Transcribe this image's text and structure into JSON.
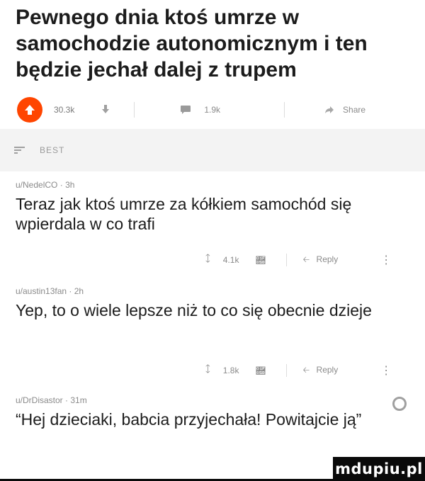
{
  "post": {
    "title": "Pewnego dnia ktoś umrze w samochodzie autonomicznym i ten będzie jechał dalej z trupem",
    "upvotes": "30.3k",
    "comments_count": "1.9k",
    "share_label": "Share"
  },
  "sort": {
    "label": "BEST"
  },
  "comments": [
    {
      "user": "u/NedelCO",
      "age": "3h",
      "text": "Teraz jak ktoś umrze za kółkiem samochód się wpierdala w co trafi",
      "score": "4.1k",
      "reply_label": "Reply"
    },
    {
      "user": "u/austin13fan",
      "age": "2h",
      "text": "Yep, to o wiele lepsze niż to co się obecnie dzieje",
      "score": "1.8k",
      "reply_label": "Reply"
    },
    {
      "user": "u/DrDisastor",
      "age": "31m",
      "text": "“Hej dzieciaki, babcia przyjechała! Powitajcie ją”"
    }
  ],
  "watermark": {
    "text": "mdupiu.pl"
  },
  "colors": {
    "upvote_accent": "#ff4500",
    "text": "#1c1c1c",
    "muted": "#8a8a8a"
  },
  "icons": {
    "upvote": "arrow-up-icon",
    "downvote": "arrow-down-icon",
    "comment": "comment-bubble-icon",
    "share": "share-icon",
    "sort": "sort-icon",
    "reply": "reply-icon",
    "more": "more-options-icon",
    "award": "award-icon"
  }
}
